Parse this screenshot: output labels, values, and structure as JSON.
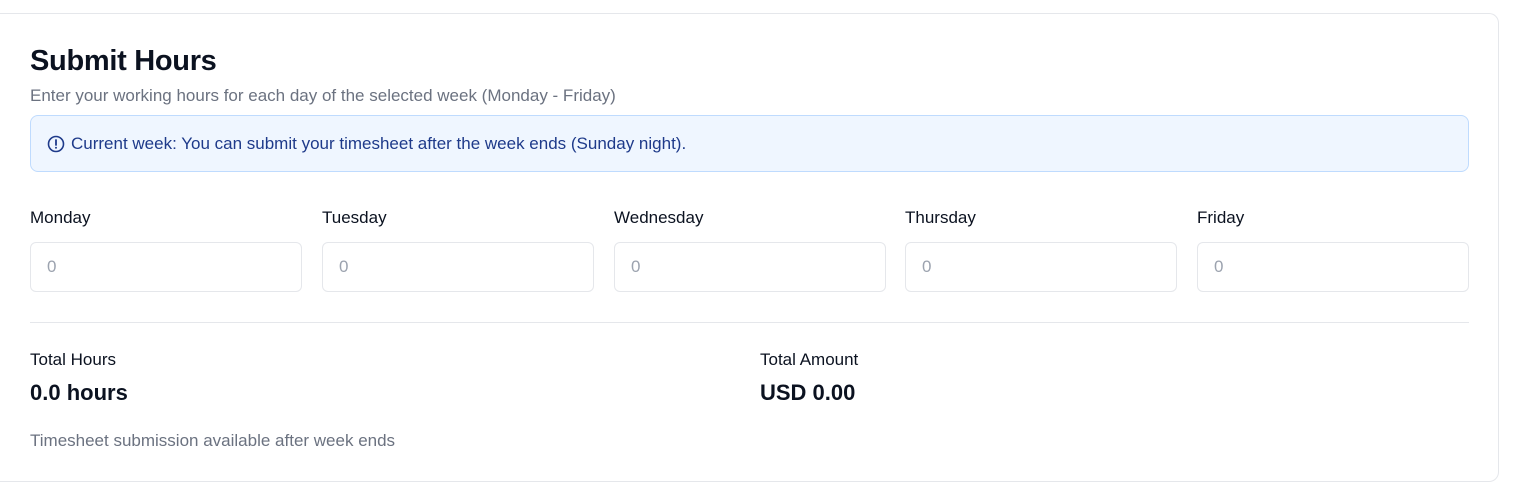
{
  "card": {
    "title": "Submit Hours",
    "subtitle": "Enter your working hours for each day of the selected week (Monday - Friday)"
  },
  "alert": {
    "icon": "info-circle-icon",
    "message": "Current week: You can submit your timesheet after the week ends (Sunday night)."
  },
  "days": [
    {
      "label": "Monday",
      "placeholder": "0"
    },
    {
      "label": "Tuesday",
      "placeholder": "0"
    },
    {
      "label": "Wednesday",
      "placeholder": "0"
    },
    {
      "label": "Thursday",
      "placeholder": "0"
    },
    {
      "label": "Friday",
      "placeholder": "0"
    }
  ],
  "summary": {
    "total_hours_label": "Total Hours",
    "total_hours_value": "0.0 hours",
    "total_amount_label": "Total Amount",
    "total_amount_value": "USD 0.00"
  },
  "footnote": "Timesheet submission available after week ends",
  "colors": {
    "alert_background": "#eff6ff",
    "alert_border": "#bfdbfe",
    "alert_text": "#1e3a8a",
    "muted_text": "#6b7280"
  }
}
